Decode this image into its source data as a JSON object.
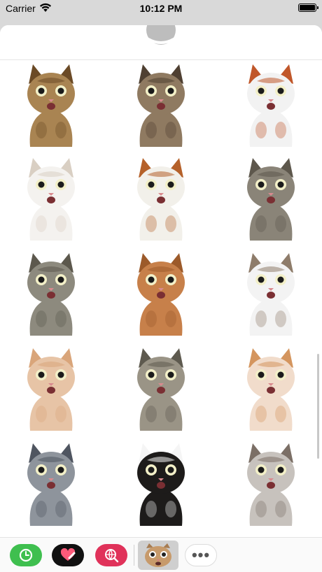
{
  "status_bar": {
    "carrier": "Carrier",
    "time": "10:12 PM",
    "wifi_icon": "wifi-icon",
    "battery_icon": "battery-icon"
  },
  "sheet": {
    "handle_icon": "chevron-down-icon"
  },
  "stickers": [
    {
      "name": "cat-sticker-1",
      "body": "#a98452",
      "accent": "#6b4a26"
    },
    {
      "name": "cat-sticker-2",
      "body": "#8f7a61",
      "accent": "#4f4032"
    },
    {
      "name": "cat-sticker-3",
      "body": "#f2f2f2",
      "accent": "#c0572a"
    },
    {
      "name": "cat-sticker-4",
      "body": "#f4f2ef",
      "accent": "#d9cfc3"
    },
    {
      "name": "cat-sticker-5",
      "body": "#f2f0ea",
      "accent": "#b5612a"
    },
    {
      "name": "cat-sticker-6",
      "body": "#8a8478",
      "accent": "#5d574c"
    },
    {
      "name": "cat-sticker-7",
      "body": "#8d8a7e",
      "accent": "#5c584d"
    },
    {
      "name": "cat-sticker-8",
      "body": "#c7804a",
      "accent": "#9c5a2a"
    },
    {
      "name": "cat-sticker-9",
      "body": "#f3f3f3",
      "accent": "#8e7c6a"
    },
    {
      "name": "cat-sticker-10",
      "body": "#e7c4a6",
      "accent": "#d9a57a"
    },
    {
      "name": "cat-sticker-11",
      "body": "#9a9486",
      "accent": "#5e5a4f"
    },
    {
      "name": "cat-sticker-12",
      "body": "#f1dccb",
      "accent": "#d4955e"
    },
    {
      "name": "cat-sticker-13",
      "body": "#8e949c",
      "accent": "#4f5560"
    },
    {
      "name": "cat-sticker-14",
      "body": "#1d1b1a",
      "accent": "#f5f5f5"
    },
    {
      "name": "cat-sticker-15",
      "body": "#c7c2bd",
      "accent": "#7b6f66"
    }
  ],
  "app_drawer": {
    "apps": [
      {
        "name": "app-clock-button",
        "icon": "clock-icon",
        "color": "#3fbf4f"
      },
      {
        "name": "app-digital-touch-button",
        "icon": "heart-touch-icon",
        "color": "#111111"
      },
      {
        "name": "app-search-button",
        "icon": "globe-search-icon",
        "color": "#e0325a"
      },
      {
        "name": "app-cat-stickers-button",
        "icon": "cat-face-icon",
        "color": "#cfcfcf"
      },
      {
        "name": "app-more-button",
        "icon": "more-icon",
        "label": "•••"
      }
    ]
  }
}
